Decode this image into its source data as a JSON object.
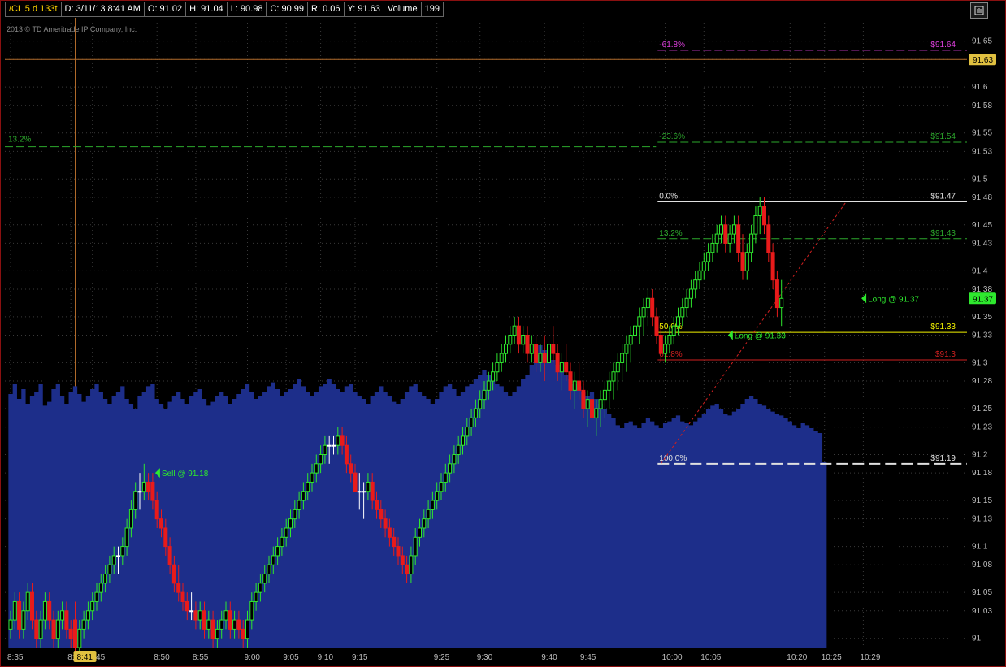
{
  "header": {
    "symbol": "/CL 5 d 133t",
    "date": "D: 3/11/13 8:41 AM",
    "open": "O: 91.02",
    "high": "H: 91.04",
    "low": "L: 90.98",
    "close": "C: 90.99",
    "range": "R: 0.06",
    "y": "Y: 91.63",
    "volume_label": "Volume",
    "volume_value": "199"
  },
  "copyright": "2013 © TD Ameritrade IP Company, Inc.",
  "colors": {
    "up": "#2ee82e",
    "down": "#e81b1b",
    "doji": "#ffffff",
    "volume": "#1d2e8a",
    "grid": "#3a3a3a",
    "fib_magenta": "#e040e0",
    "fib_green": "#2ca82c",
    "fib_white": "#e0e0e0",
    "fib_yellow": "#f2f200",
    "fib_red": "#d02020",
    "order_green": "#2ee82e",
    "price_bubble": "#2ee82e",
    "crosshair_bubble": "#e0c040"
  },
  "chart_data": {
    "type": "candlestick",
    "title": "",
    "ylim": [
      90.99,
      91.67
    ],
    "y_ticks": [
      "91.65",
      "91.63",
      "91.6",
      "91.58",
      "91.55",
      "91.53",
      "91.5",
      "91.48",
      "91.45",
      "91.43",
      "91.4",
      "91.38",
      "91.35",
      "91.33",
      "91.3",
      "91.28",
      "91.25",
      "91.23",
      "91.2",
      "91.18",
      "91.15",
      "91.13",
      "91.1",
      "91.08",
      "91.05",
      "91.03",
      "91"
    ],
    "y_tick_values": [
      91.65,
      91.63,
      91.6,
      91.58,
      91.55,
      91.53,
      91.5,
      91.48,
      91.45,
      91.43,
      91.4,
      91.38,
      91.35,
      91.33,
      91.3,
      91.28,
      91.25,
      91.23,
      91.2,
      91.18,
      91.15,
      91.13,
      91.1,
      91.08,
      91.05,
      91.03,
      91.0
    ],
    "x_ticks": [
      "8:35",
      "8:40",
      "8:45",
      "8:50",
      "8:55",
      "9:00",
      "9:05",
      "9:10",
      "9:15",
      "9:25",
      "9:30",
      "9:40",
      "9:45",
      "10:00",
      "10:05",
      "10:20",
      "10:25",
      "10:29"
    ],
    "x_tick_bar_index": [
      0,
      14,
      19,
      34,
      43,
      55,
      64,
      72,
      80,
      99,
      109,
      124,
      133,
      152,
      161,
      181,
      189,
      198
    ],
    "crosshair": {
      "x_label": "8:41",
      "bar_index": 15,
      "y_label": "91.63",
      "y_value": 91.63
    },
    "last_price": {
      "label": "91.37",
      "value": 91.37
    },
    "candles": [
      [
        91.01,
        91.03,
        91.0,
        91.02
      ],
      [
        91.02,
        91.05,
        91.01,
        91.04
      ],
      [
        91.04,
        91.05,
        91.0,
        91.01
      ],
      [
        91.01,
        91.04,
        91.0,
        91.03
      ],
      [
        91.03,
        91.06,
        91.02,
        91.05
      ],
      [
        91.05,
        91.06,
        91.01,
        91.02
      ],
      [
        91.02,
        91.03,
        90.99,
        91.0
      ],
      [
        91.0,
        91.03,
        90.99,
        91.02
      ],
      [
        91.02,
        91.05,
        91.01,
        91.04
      ],
      [
        91.04,
        91.05,
        91.01,
        91.02
      ],
      [
        91.02,
        91.03,
        90.99,
        91.0
      ],
      [
        91.0,
        91.03,
        90.99,
        91.02
      ],
      [
        91.02,
        91.04,
        91.01,
        91.03
      ],
      [
        91.03,
        91.04,
        91.0,
        91.01
      ],
      [
        91.01,
        91.02,
        90.99,
        91.0
      ],
      [
        91.02,
        91.04,
        90.98,
        90.99
      ],
      [
        90.99,
        91.02,
        90.98,
        91.01
      ],
      [
        91.01,
        91.03,
        91.0,
        91.02
      ],
      [
        91.02,
        91.04,
        91.01,
        91.03
      ],
      [
        91.03,
        91.05,
        91.02,
        91.04
      ],
      [
        91.04,
        91.06,
        91.03,
        91.05
      ],
      [
        91.05,
        91.07,
        91.04,
        91.06
      ],
      [
        91.06,
        91.08,
        91.05,
        91.07
      ],
      [
        91.07,
        91.09,
        91.06,
        91.08
      ],
      [
        91.08,
        91.1,
        91.07,
        91.09
      ],
      [
        91.09,
        91.1,
        91.07,
        91.09
      ],
      [
        91.09,
        91.11,
        91.08,
        91.1
      ],
      [
        91.1,
        91.13,
        91.09,
        91.12
      ],
      [
        91.12,
        91.15,
        91.11,
        91.14
      ],
      [
        91.14,
        91.17,
        91.13,
        91.16
      ],
      [
        91.16,
        91.18,
        91.14,
        91.16
      ],
      [
        91.16,
        91.19,
        91.15,
        91.17
      ],
      [
        91.17,
        91.18,
        91.15,
        91.16
      ],
      [
        91.17,
        91.18,
        91.14,
        91.15
      ],
      [
        91.15,
        91.16,
        91.12,
        91.13
      ],
      [
        91.13,
        91.14,
        91.11,
        91.12
      ],
      [
        91.12,
        91.13,
        91.09,
        91.1
      ],
      [
        91.1,
        91.11,
        91.07,
        91.08
      ],
      [
        91.08,
        91.09,
        91.05,
        91.06
      ],
      [
        91.06,
        91.08,
        91.04,
        91.05
      ],
      [
        91.05,
        91.06,
        91.03,
        91.04
      ],
      [
        91.04,
        91.05,
        91.02,
        91.03
      ],
      [
        91.03,
        91.05,
        91.02,
        91.03
      ],
      [
        91.03,
        91.04,
        91.01,
        91.02
      ],
      [
        91.02,
        91.04,
        91.01,
        91.03
      ],
      [
        91.03,
        91.04,
        91.0,
        91.01
      ],
      [
        91.01,
        91.03,
        91.0,
        91.02
      ],
      [
        91.02,
        91.03,
        90.99,
        91.0
      ],
      [
        91.0,
        91.02,
        90.99,
        91.01
      ],
      [
        91.01,
        91.03,
        91.0,
        91.02
      ],
      [
        91.02,
        91.04,
        91.01,
        91.03
      ],
      [
        91.03,
        91.04,
        91.0,
        91.01
      ],
      [
        91.01,
        91.03,
        91.0,
        91.02
      ],
      [
        91.02,
        91.03,
        91.0,
        91.01
      ],
      [
        91.01,
        91.02,
        90.99,
        91.0
      ],
      [
        91.0,
        91.03,
        90.99,
        91.02
      ],
      [
        91.02,
        91.05,
        91.01,
        91.04
      ],
      [
        91.04,
        91.06,
        91.03,
        91.05
      ],
      [
        91.05,
        91.07,
        91.04,
        91.06
      ],
      [
        91.06,
        91.08,
        91.05,
        91.07
      ],
      [
        91.07,
        91.09,
        91.06,
        91.08
      ],
      [
        91.08,
        91.1,
        91.07,
        91.09
      ],
      [
        91.09,
        91.11,
        91.08,
        91.1
      ],
      [
        91.1,
        91.12,
        91.09,
        91.11
      ],
      [
        91.11,
        91.13,
        91.1,
        91.12
      ],
      [
        91.12,
        91.14,
        91.11,
        91.13
      ],
      [
        91.13,
        91.15,
        91.12,
        91.14
      ],
      [
        91.14,
        91.16,
        91.13,
        91.15
      ],
      [
        91.15,
        91.17,
        91.14,
        91.16
      ],
      [
        91.16,
        91.18,
        91.15,
        91.17
      ],
      [
        91.17,
        91.19,
        91.16,
        91.18
      ],
      [
        91.18,
        91.2,
        91.17,
        91.19
      ],
      [
        91.19,
        91.21,
        91.18,
        91.2
      ],
      [
        91.2,
        91.22,
        91.19,
        91.21
      ],
      [
        91.21,
        91.22,
        91.19,
        91.21
      ],
      [
        91.21,
        91.22,
        91.2,
        91.21
      ],
      [
        91.21,
        91.23,
        91.2,
        91.22
      ],
      [
        91.22,
        91.23,
        91.2,
        91.21
      ],
      [
        91.21,
        91.22,
        91.18,
        91.19
      ],
      [
        91.19,
        91.2,
        91.17,
        91.18
      ],
      [
        91.18,
        91.19,
        91.16,
        91.16
      ],
      [
        91.16,
        91.18,
        91.14,
        91.16
      ],
      [
        91.16,
        91.17,
        91.13,
        91.16
      ],
      [
        91.16,
        91.18,
        91.15,
        91.17
      ],
      [
        91.17,
        91.18,
        91.14,
        91.15
      ],
      [
        91.15,
        91.16,
        91.13,
        91.14
      ],
      [
        91.14,
        91.15,
        91.12,
        91.13
      ],
      [
        91.13,
        91.14,
        91.11,
        91.12
      ],
      [
        91.12,
        91.13,
        91.1,
        91.11
      ],
      [
        91.11,
        91.12,
        91.09,
        91.1
      ],
      [
        91.1,
        91.11,
        91.08,
        91.09
      ],
      [
        91.09,
        91.1,
        91.07,
        91.08
      ],
      [
        91.08,
        91.09,
        91.06,
        91.07
      ],
      [
        91.07,
        91.1,
        91.06,
        91.09
      ],
      [
        91.09,
        91.12,
        91.08,
        91.11
      ],
      [
        91.11,
        91.13,
        91.1,
        91.12
      ],
      [
        91.12,
        91.14,
        91.11,
        91.13
      ],
      [
        91.13,
        91.15,
        91.12,
        91.14
      ],
      [
        91.14,
        91.16,
        91.13,
        91.15
      ],
      [
        91.15,
        91.17,
        91.14,
        91.16
      ],
      [
        91.16,
        91.18,
        91.15,
        91.17
      ],
      [
        91.17,
        91.19,
        91.16,
        91.18
      ],
      [
        91.18,
        91.2,
        91.17,
        91.19
      ],
      [
        91.19,
        91.21,
        91.18,
        91.2
      ],
      [
        91.2,
        91.22,
        91.19,
        91.21
      ],
      [
        91.21,
        91.23,
        91.2,
        91.22
      ],
      [
        91.22,
        91.24,
        91.21,
        91.23
      ],
      [
        91.23,
        91.25,
        91.22,
        91.24
      ],
      [
        91.24,
        91.26,
        91.23,
        91.25
      ],
      [
        91.25,
        91.27,
        91.24,
        91.26
      ],
      [
        91.26,
        91.28,
        91.25,
        91.27
      ],
      [
        91.27,
        91.29,
        91.26,
        91.28
      ],
      [
        91.28,
        91.3,
        91.27,
        91.29
      ],
      [
        91.29,
        91.31,
        91.28,
        91.3
      ],
      [
        91.3,
        91.32,
        91.29,
        91.31
      ],
      [
        91.31,
        91.33,
        91.3,
        91.32
      ],
      [
        91.32,
        91.34,
        91.31,
        91.33
      ],
      [
        91.33,
        91.35,
        91.32,
        91.34
      ],
      [
        91.34,
        91.35,
        91.31,
        91.32
      ],
      [
        91.32,
        91.34,
        91.31,
        91.33
      ],
      [
        91.33,
        91.34,
        91.3,
        91.31
      ],
      [
        91.31,
        91.33,
        91.3,
        91.32
      ],
      [
        91.32,
        91.33,
        91.29,
        91.3
      ],
      [
        91.3,
        91.32,
        91.29,
        91.31
      ],
      [
        91.31,
        91.33,
        91.28,
        91.3
      ],
      [
        91.3,
        91.33,
        91.29,
        91.32
      ],
      [
        91.32,
        91.34,
        91.3,
        91.31
      ],
      [
        91.31,
        91.32,
        91.28,
        91.29
      ],
      [
        91.29,
        91.31,
        91.27,
        91.3
      ],
      [
        91.3,
        91.32,
        91.28,
        91.29
      ],
      [
        91.29,
        91.3,
        91.26,
        91.27
      ],
      [
        91.27,
        91.29,
        91.25,
        91.28
      ],
      [
        91.28,
        91.3,
        91.26,
        91.27
      ],
      [
        91.27,
        91.28,
        91.24,
        91.25
      ],
      [
        91.25,
        91.27,
        91.23,
        91.26
      ],
      [
        91.26,
        91.27,
        91.23,
        91.24
      ],
      [
        91.24,
        91.26,
        91.22,
        91.25
      ],
      [
        91.25,
        91.27,
        91.23,
        91.26
      ],
      [
        91.26,
        91.28,
        91.24,
        91.27
      ],
      [
        91.27,
        91.29,
        91.25,
        91.28
      ],
      [
        91.28,
        91.3,
        91.26,
        91.29
      ],
      [
        91.29,
        91.31,
        91.27,
        91.3
      ],
      [
        91.3,
        91.32,
        91.28,
        91.31
      ],
      [
        91.31,
        91.33,
        91.29,
        91.32
      ],
      [
        91.32,
        91.34,
        91.3,
        91.33
      ],
      [
        91.33,
        91.35,
        91.31,
        91.34
      ],
      [
        91.34,
        91.36,
        91.32,
        91.35
      ],
      [
        91.35,
        91.37,
        91.33,
        91.36
      ],
      [
        91.36,
        91.38,
        91.34,
        91.37
      ],
      [
        91.37,
        91.38,
        91.34,
        91.35
      ],
      [
        91.35,
        91.36,
        91.32,
        91.33
      ],
      [
        91.33,
        91.34,
        91.3,
        91.31
      ],
      [
        91.31,
        91.33,
        91.3,
        91.32
      ],
      [
        91.32,
        91.34,
        91.31,
        91.33
      ],
      [
        91.33,
        91.35,
        91.32,
        91.34
      ],
      [
        91.34,
        91.36,
        91.33,
        91.35
      ],
      [
        91.35,
        91.37,
        91.34,
        91.36
      ],
      [
        91.36,
        91.38,
        91.35,
        91.37
      ],
      [
        91.37,
        91.39,
        91.36,
        91.38
      ],
      [
        91.38,
        91.4,
        91.37,
        91.39
      ],
      [
        91.39,
        91.41,
        91.38,
        91.4
      ],
      [
        91.4,
        91.42,
        91.39,
        91.41
      ],
      [
        91.41,
        91.43,
        91.4,
        91.42
      ],
      [
        91.42,
        91.44,
        91.41,
        91.43
      ],
      [
        91.43,
        91.45,
        91.42,
        91.44
      ],
      [
        91.44,
        91.46,
        91.43,
        91.45
      ],
      [
        91.45,
        91.46,
        91.42,
        91.43
      ],
      [
        91.43,
        91.45,
        91.42,
        91.44
      ],
      [
        91.44,
        91.46,
        91.43,
        91.45
      ],
      [
        91.45,
        91.46,
        91.41,
        91.42
      ],
      [
        91.42,
        91.44,
        91.39,
        91.4
      ],
      [
        91.4,
        91.43,
        91.39,
        91.42
      ],
      [
        91.42,
        91.45,
        91.41,
        91.44
      ],
      [
        91.44,
        91.47,
        91.43,
        91.46
      ],
      [
        91.46,
        91.48,
        91.44,
        91.47
      ],
      [
        91.47,
        91.48,
        91.44,
        91.45
      ],
      [
        91.45,
        91.46,
        91.41,
        91.42
      ],
      [
        91.42,
        91.43,
        91.38,
        91.39
      ],
      [
        91.39,
        91.4,
        91.35,
        91.36
      ],
      [
        91.36,
        91.39,
        91.34,
        91.37
      ]
    ],
    "volume_max": 500,
    "volume": [
      260,
      270,
      255,
      265,
      250,
      258,
      262,
      270,
      248,
      252,
      265,
      270,
      258,
      250,
      262,
      268,
      260,
      252,
      258,
      265,
      270,
      262,
      255,
      250,
      258,
      262,
      268,
      255,
      250,
      245,
      258,
      262,
      268,
      270,
      255,
      250,
      245,
      252,
      258,
      262,
      255,
      250,
      258,
      262,
      265,
      255,
      248,
      252,
      258,
      262,
      258,
      250,
      255,
      260,
      265,
      270,
      262,
      255,
      258,
      262,
      268,
      272,
      265,
      258,
      262,
      265,
      270,
      275,
      268,
      262,
      258,
      262,
      268,
      270,
      275,
      270,
      265,
      262,
      268,
      270,
      262,
      258,
      255,
      250,
      258,
      262,
      268,
      262,
      258,
      252,
      250,
      255,
      262,
      268,
      270,
      262,
      258,
      255,
      250,
      255,
      262,
      268,
      270,
      265,
      258,
      262,
      268,
      270,
      275,
      280,
      285,
      280,
      275,
      270,
      268,
      262,
      258,
      262,
      268,
      275,
      280,
      290,
      300,
      310,
      305,
      300,
      295,
      290,
      285,
      280,
      275,
      270,
      268,
      262,
      258,
      262,
      255,
      250,
      245,
      240,
      235,
      228,
      225,
      230,
      232,
      228,
      225,
      230,
      235,
      232,
      228,
      225,
      230,
      232,
      235,
      238,
      232,
      230,
      228,
      232,
      236,
      240,
      245,
      248,
      250,
      245,
      240,
      238,
      242,
      245,
      250,
      255,
      258,
      255,
      250,
      248,
      245,
      242,
      240,
      238,
      235,
      232,
      228,
      225,
      230,
      228,
      225,
      222,
      220,
      190
    ],
    "fib_levels": [
      {
        "pct": "-61.8%",
        "price_label": "$91.64",
        "value": 91.64,
        "color_key": "fib_magenta",
        "dash": "dashed"
      },
      {
        "pct": "-23.6%",
        "price_label": "$91.54",
        "value": 91.54,
        "color_key": "fib_green",
        "dash": "dashed"
      },
      {
        "pct": "0.0%",
        "price_label": "$91.47",
        "value": 91.475,
        "color_key": "fib_white",
        "dash": "solid"
      },
      {
        "pct": "13.2%",
        "price_label": "$91.43",
        "value": 91.435,
        "color_key": "fib_green",
        "dash": "dashed"
      },
      {
        "pct": "50.0%",
        "price_label": "$91.33",
        "value": 91.333,
        "color_key": "fib_yellow",
        "dash": "solid"
      },
      {
        "pct": "61.8%",
        "price_label": "$91.3",
        "value": 91.303,
        "color_key": "fib_red",
        "dash": "solid"
      },
      {
        "pct": "100.0%",
        "price_label": "$91.19",
        "value": 91.19,
        "color_key": "fib_white",
        "dash": "wide-dashed"
      }
    ],
    "fib_start_bar": 151,
    "fib_trend": {
      "from_bar": 151,
      "from_value": 91.19,
      "to_bar": 194,
      "to_value": 91.475
    },
    "left_level": {
      "label": "13.2%",
      "value": 91.535
    },
    "orders": [
      {
        "label": "Sell @ 91.18",
        "bar_index": 33,
        "value": 91.18
      },
      {
        "label": "Long @ 91.33",
        "bar_index": 166,
        "value": 91.33
      },
      {
        "label": "Long @ 91.37",
        "bar_index": 197,
        "value": 91.37
      }
    ]
  }
}
